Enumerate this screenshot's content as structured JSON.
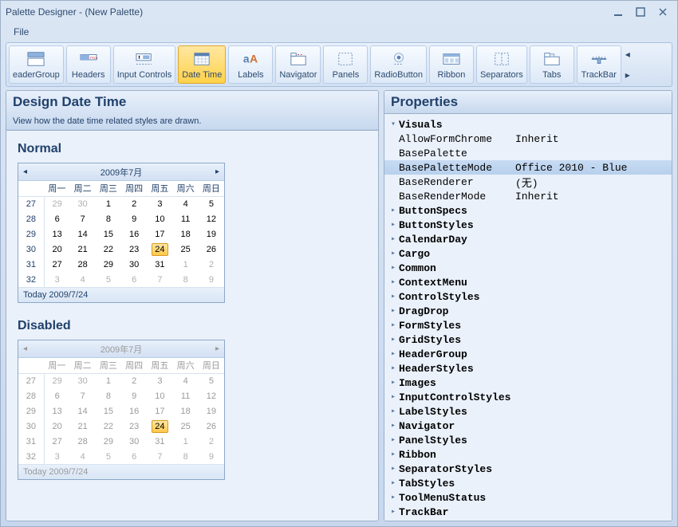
{
  "window": {
    "title": "Palette Designer - (New Palette)"
  },
  "menu": {
    "file": "File"
  },
  "toolbar": {
    "items": [
      {
        "id": "headergroup",
        "label": "eaderGroup"
      },
      {
        "id": "headers",
        "label": "Headers"
      },
      {
        "id": "inputcontrols",
        "label": "Input Controls"
      },
      {
        "id": "datetime",
        "label": "Date Time",
        "active": true
      },
      {
        "id": "labels",
        "label": "Labels"
      },
      {
        "id": "navigator",
        "label": "Navigator"
      },
      {
        "id": "panels",
        "label": "Panels"
      },
      {
        "id": "radiobutton",
        "label": "RadioButton"
      },
      {
        "id": "ribbon",
        "label": "Ribbon"
      },
      {
        "id": "separators",
        "label": "Separators"
      },
      {
        "id": "tabs",
        "label": "Tabs"
      },
      {
        "id": "trackbar",
        "label": "TrackBar"
      }
    ]
  },
  "design": {
    "title": "Design Date Time",
    "subtitle": "View how the date time related styles are drawn.",
    "normal_label": "Normal",
    "disabled_label": "Disabled"
  },
  "calendar": {
    "header": "2009年7月",
    "dow": [
      "",
      "周一",
      "周二",
      "周三",
      "周四",
      "周五",
      "周六",
      "周日"
    ],
    "rows": [
      {
        "wk": "27",
        "days": [
          {
            "n": "29",
            "dim": true
          },
          {
            "n": "30",
            "dim": true
          },
          {
            "n": "1"
          },
          {
            "n": "2"
          },
          {
            "n": "3"
          },
          {
            "n": "4"
          },
          {
            "n": "5"
          }
        ]
      },
      {
        "wk": "28",
        "days": [
          {
            "n": "6"
          },
          {
            "n": "7"
          },
          {
            "n": "8"
          },
          {
            "n": "9"
          },
          {
            "n": "10"
          },
          {
            "n": "11"
          },
          {
            "n": "12"
          }
        ]
      },
      {
        "wk": "29",
        "days": [
          {
            "n": "13"
          },
          {
            "n": "14"
          },
          {
            "n": "15"
          },
          {
            "n": "16"
          },
          {
            "n": "17"
          },
          {
            "n": "18"
          },
          {
            "n": "19"
          }
        ]
      },
      {
        "wk": "30",
        "days": [
          {
            "n": "20"
          },
          {
            "n": "21"
          },
          {
            "n": "22"
          },
          {
            "n": "23"
          },
          {
            "n": "24",
            "today": true
          },
          {
            "n": "25"
          },
          {
            "n": "26"
          }
        ]
      },
      {
        "wk": "31",
        "days": [
          {
            "n": "27"
          },
          {
            "n": "28"
          },
          {
            "n": "29"
          },
          {
            "n": "30"
          },
          {
            "n": "31"
          },
          {
            "n": "1",
            "dim": true
          },
          {
            "n": "2",
            "dim": true
          }
        ]
      },
      {
        "wk": "32",
        "days": [
          {
            "n": "3",
            "dim": true
          },
          {
            "n": "4",
            "dim": true
          },
          {
            "n": "5",
            "dim": true
          },
          {
            "n": "6",
            "dim": true
          },
          {
            "n": "7",
            "dim": true
          },
          {
            "n": "8",
            "dim": true
          },
          {
            "n": "9",
            "dim": true
          }
        ]
      }
    ],
    "footer": "Today 2009/7/24"
  },
  "properties": {
    "title": "Properties",
    "rows": [
      {
        "type": "group",
        "name": "Visuals",
        "expanded": true
      },
      {
        "type": "child",
        "name": "AllowFormChrome",
        "value": "Inherit"
      },
      {
        "type": "child",
        "name": "BasePalette",
        "value": ""
      },
      {
        "type": "child",
        "name": "BasePaletteMode",
        "value": "Office 2010 - Blue",
        "selected": true
      },
      {
        "type": "child",
        "name": "BaseRenderer",
        "value": "(无)"
      },
      {
        "type": "child",
        "name": "BaseRenderMode",
        "value": "Inherit"
      },
      {
        "type": "group",
        "name": "ButtonSpecs"
      },
      {
        "type": "group",
        "name": "ButtonStyles"
      },
      {
        "type": "group",
        "name": "CalendarDay"
      },
      {
        "type": "group",
        "name": "Cargo"
      },
      {
        "type": "group",
        "name": "Common"
      },
      {
        "type": "group",
        "name": "ContextMenu"
      },
      {
        "type": "group",
        "name": "ControlStyles"
      },
      {
        "type": "group",
        "name": "DragDrop"
      },
      {
        "type": "group",
        "name": "FormStyles"
      },
      {
        "type": "group",
        "name": "GridStyles"
      },
      {
        "type": "group",
        "name": "HeaderGroup"
      },
      {
        "type": "group",
        "name": "HeaderStyles"
      },
      {
        "type": "group",
        "name": "Images"
      },
      {
        "type": "group",
        "name": "InputControlStyles"
      },
      {
        "type": "group",
        "name": "LabelStyles"
      },
      {
        "type": "group",
        "name": "Navigator"
      },
      {
        "type": "group",
        "name": "PanelStyles"
      },
      {
        "type": "group",
        "name": "Ribbon"
      },
      {
        "type": "group",
        "name": "SeparatorStyles"
      },
      {
        "type": "group",
        "name": "TabStyles"
      },
      {
        "type": "group",
        "name": "ToolMenuStatus"
      },
      {
        "type": "group",
        "name": "TrackBar"
      }
    ]
  }
}
